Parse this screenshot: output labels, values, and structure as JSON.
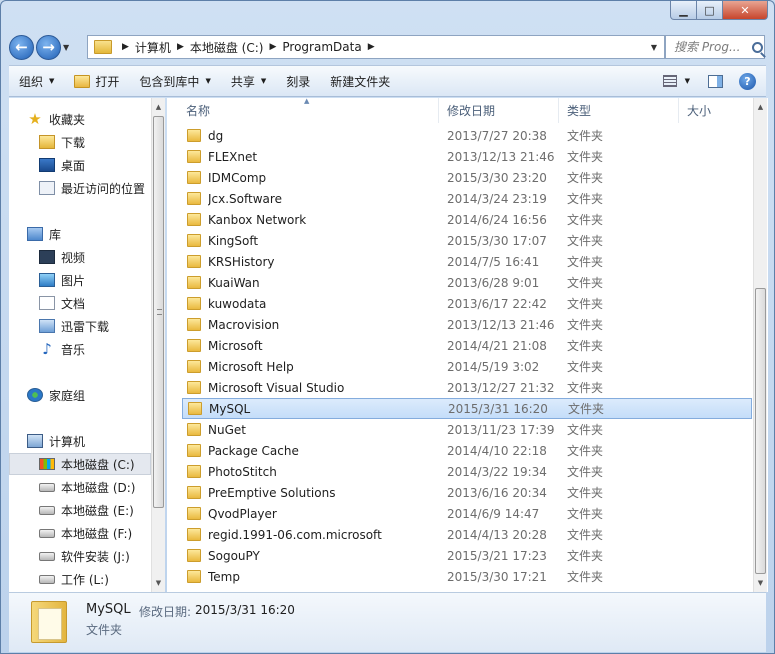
{
  "window": {
    "min_glyph": "▁",
    "max_glyph": "□",
    "close_glyph": "✕"
  },
  "nav": {
    "back_glyph": "←",
    "forward_glyph": "→",
    "recent_glyph": "▼",
    "breadcrumb": [
      "计算机",
      "本地磁盘 (C:)",
      "ProgramData"
    ],
    "sep_glyph": "▶",
    "dropdown_glyph": "▼",
    "refresh_glyph": "⟳",
    "search_placeholder": "搜索 Prog..."
  },
  "toolbar": {
    "organize": "组织",
    "open": "打开",
    "include_in_library": "包含到库中",
    "share": "共享",
    "burn": "刻录",
    "new_folder": "新建文件夹",
    "arrow_glyph": "▼",
    "help_glyph": "?"
  },
  "sidebar": {
    "items": [
      {
        "label": "收藏夹",
        "icon": "star-icon"
      },
      {
        "label": "下载",
        "icon": "downloads-icon"
      },
      {
        "label": "桌面",
        "icon": "desktop-icon"
      },
      {
        "label": "最近访问的位置",
        "icon": "recent-places-icon"
      },
      {
        "label": "库",
        "icon": "libraries-icon"
      },
      {
        "label": "视频",
        "icon": "videos-icon"
      },
      {
        "label": "图片",
        "icon": "pictures-icon"
      },
      {
        "label": "文档",
        "icon": "documents-icon"
      },
      {
        "label": "迅雷下载",
        "icon": "thunder-icon"
      },
      {
        "label": "音乐",
        "icon": "music-icon"
      },
      {
        "label": "家庭组",
        "icon": "homegroup-icon"
      },
      {
        "label": "计算机",
        "icon": "computer-icon"
      },
      {
        "label": "本地磁盘 (C:)",
        "icon": "system-drive-icon"
      },
      {
        "label": "本地磁盘 (D:)",
        "icon": "drive-icon"
      },
      {
        "label": "本地磁盘 (E:)",
        "icon": "drive-icon"
      },
      {
        "label": "本地磁盘 (F:)",
        "icon": "drive-icon"
      },
      {
        "label": "软件安装 (J:)",
        "icon": "drive-icon"
      },
      {
        "label": "工作 (L:)",
        "icon": "drive-icon"
      }
    ],
    "selected_index": 12
  },
  "columns": {
    "name": "名称",
    "date": "修改日期",
    "type": "类型",
    "size": "大小"
  },
  "files": [
    {
      "name": "dg",
      "date": "2013/7/27 20:38",
      "type": "文件夹"
    },
    {
      "name": "FLEXnet",
      "date": "2013/12/13 21:46",
      "type": "文件夹"
    },
    {
      "name": "IDMComp",
      "date": "2015/3/30 23:20",
      "type": "文件夹"
    },
    {
      "name": "Jcx.Software",
      "date": "2014/3/24 23:19",
      "type": "文件夹"
    },
    {
      "name": "Kanbox Network",
      "date": "2014/6/24 16:56",
      "type": "文件夹"
    },
    {
      "name": "KingSoft",
      "date": "2015/3/30 17:07",
      "type": "文件夹"
    },
    {
      "name": "KRSHistory",
      "date": "2014/7/5 16:41",
      "type": "文件夹"
    },
    {
      "name": "KuaiWan",
      "date": "2013/6/28 9:01",
      "type": "文件夹"
    },
    {
      "name": "kuwodata",
      "date": "2013/6/17 22:42",
      "type": "文件夹"
    },
    {
      "name": "Macrovision",
      "date": "2013/12/13 21:46",
      "type": "文件夹"
    },
    {
      "name": "Microsoft",
      "date": "2014/4/21 21:08",
      "type": "文件夹"
    },
    {
      "name": "Microsoft Help",
      "date": "2014/5/19 3:02",
      "type": "文件夹"
    },
    {
      "name": "Microsoft Visual Studio",
      "date": "2013/12/27 21:32",
      "type": "文件夹"
    },
    {
      "name": "MySQL",
      "date": "2015/3/31 16:20",
      "type": "文件夹"
    },
    {
      "name": "NuGet",
      "date": "2013/11/23 17:39",
      "type": "文件夹"
    },
    {
      "name": "Package Cache",
      "date": "2014/4/10 22:18",
      "type": "文件夹"
    },
    {
      "name": "PhotoStitch",
      "date": "2014/3/22 19:34",
      "type": "文件夹"
    },
    {
      "name": "PreEmptive Solutions",
      "date": "2013/6/16 20:34",
      "type": "文件夹"
    },
    {
      "name": "QvodPlayer",
      "date": "2014/6/9 14:47",
      "type": "文件夹"
    },
    {
      "name": "regid.1991-06.com.microsoft",
      "date": "2014/4/13 20:28",
      "type": "文件夹"
    },
    {
      "name": "SogouPY",
      "date": "2015/3/21 17:23",
      "type": "文件夹"
    },
    {
      "name": "Temp",
      "date": "2015/3/30 17:21",
      "type": "文件夹"
    }
  ],
  "selected_file_index": 13,
  "details": {
    "name": "MySQL",
    "date_label": "修改日期:",
    "date": "2015/3/31 16:20",
    "type": "文件夹"
  },
  "scroll": {
    "up_glyph": "▲",
    "down_glyph": "▼",
    "sort_glyph": "▲"
  }
}
